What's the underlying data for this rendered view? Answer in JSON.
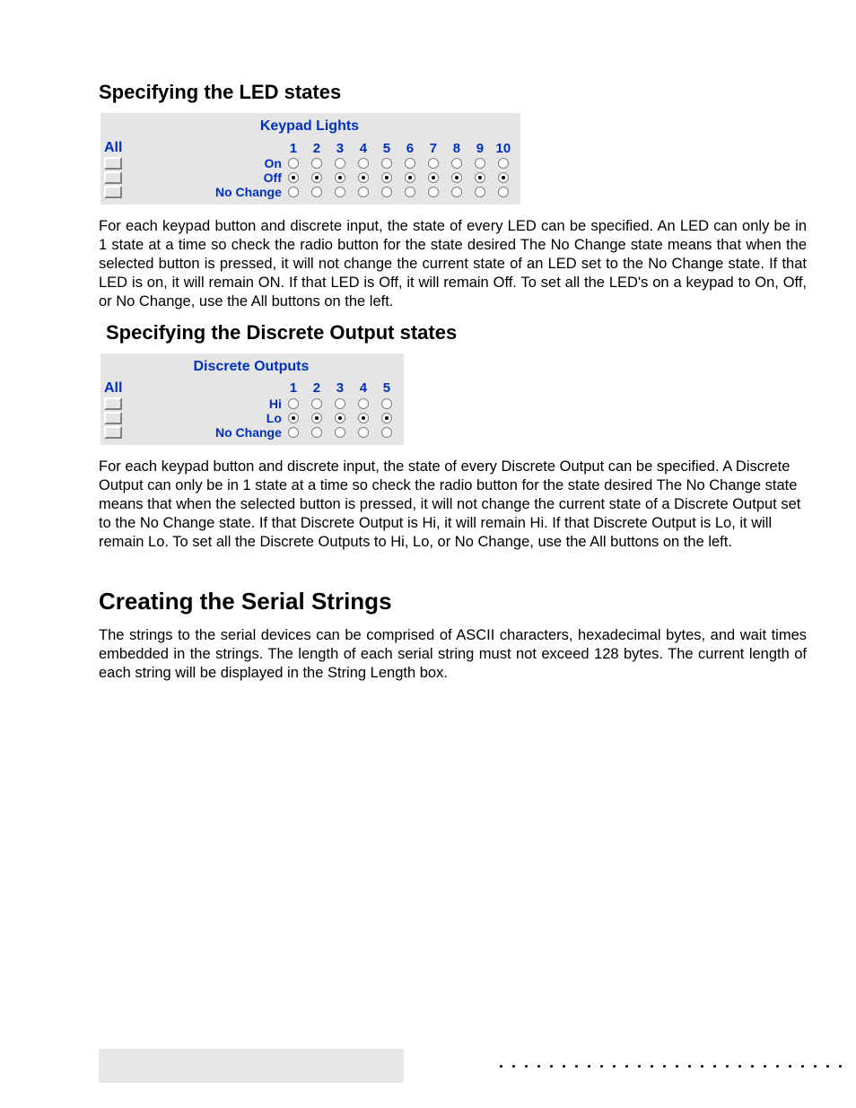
{
  "led": {
    "heading": "Specifying the LED states",
    "panel_title": "Keypad Lights",
    "all_label": "All",
    "columns": [
      "1",
      "2",
      "3",
      "4",
      "5",
      "6",
      "7",
      "8",
      "9",
      "10"
    ],
    "rows": [
      {
        "label": "On",
        "selected": false
      },
      {
        "label": "Off",
        "selected": true
      },
      {
        "label": "No Change",
        "selected": false
      }
    ],
    "paragraph": "For each keypad button and discrete input, the state of every LED can be specified.  An LED can only be in 1 state at a time so check the radio button for the state desired The No Change state means that when the selected button is pressed, it will not change the current state of an LED set to the No Change state. If that LED is on, it will remain ON. If that LED is Off, it will remain Off. To set all the LED's on a keypad to On, Off, or No Change, use the All buttons on the left."
  },
  "discrete": {
    "heading": "Specifying the Discrete Output states",
    "panel_title": "Discrete Outputs",
    "all_label": "All",
    "columns": [
      "1",
      "2",
      "3",
      "4",
      "5"
    ],
    "rows": [
      {
        "label": "Hi",
        "selected": false
      },
      {
        "label": "Lo",
        "selected": true
      },
      {
        "label": "No Change",
        "selected": false
      }
    ],
    "paragraph": "For each keypad button and discrete input, the state of every Discrete Output can be specified.  A Discrete Output can only be in 1 state at a time so check the radio button for the state desired The No Change state means that when the selected button is pressed, it will not change the current state of a Discrete Output set to the No Change state. If that Discrete Output is Hi, it will remain Hi. If that Discrete Output is Lo, it will remain Lo. To set all the Discrete Outputs to Hi, Lo, or No Change, use the All buttons on the left."
  },
  "serial": {
    "heading": "Creating the Serial Strings",
    "paragraph": "The strings to the serial devices can be comprised of ASCII characters, hexadecimal bytes, and wait times embedded in the strings. The length of each serial string must not exceed 128 bytes. The current length of each string will be displayed in the String Length box."
  },
  "footer_dot_count": 28
}
